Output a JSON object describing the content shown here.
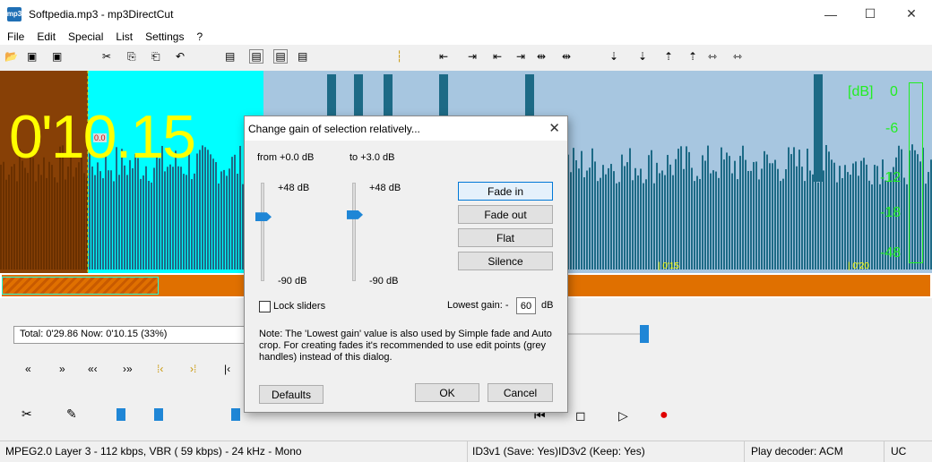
{
  "window": {
    "title": "Softpedia.mp3 - mp3DirectCut",
    "icon_text": "mp3",
    "minimize": "—",
    "maximize": "☐",
    "close": "✕"
  },
  "menu": [
    "File",
    "Edit",
    "Special",
    "List",
    "Settings",
    "?"
  ],
  "waveform": {
    "time_display": "0'10.15",
    "db_unit": "[dB]",
    "db_levels": [
      "0",
      "-6",
      "-12",
      "-18",
      "-48"
    ],
    "selection_marker": "0.0",
    "timeline_labels": [
      "0'15",
      "0'20"
    ]
  },
  "info": {
    "text": "Total: 0'29.86   Now: 0'10.15   (33%)"
  },
  "status": {
    "format": "MPEG2.0 Layer 3 - 112 kbps, VBR ( 59 kbps) - 24 kHz - Mono",
    "id3v1": "ID3v1 (Save: Yes)",
    "id3v2": "ID3v2 (Keep: Yes)",
    "decoder": "Play decoder: ACM",
    "uc": "UC"
  },
  "dialog": {
    "title": "Change gain of selection relatively...",
    "close": "✕",
    "from_label": "from +0.0 dB",
    "to_label": "to +3.0 dB",
    "from_top": "+48 dB",
    "from_bottom": "-90 dB",
    "to_top": "+48 dB",
    "to_bottom": "-90 dB",
    "from_gain_db": 0.0,
    "to_gain_db": 3.0,
    "buttons": {
      "fade_in": "Fade in",
      "fade_out": "Fade out",
      "flat": "Flat",
      "silence": "Silence"
    },
    "lock_label": "Lock sliders",
    "lowest_gain_label": "Lowest gain:  -",
    "lowest_gain_value": "60",
    "lowest_gain_unit": "dB",
    "note": "Note: The 'Lowest gain' value is also used by Simple fade and Auto crop. For creating fades it's recommended to use edit points (grey handles) instead of this dialog.",
    "defaults": "Defaults",
    "ok": "OK",
    "cancel": "Cancel"
  },
  "colors": {
    "wave_bg": "#a7c6e0",
    "wave_fg": "#1d6a86",
    "selection": "#00ffff",
    "pre_selection": "#874006",
    "time_text": "#ffff00",
    "db_text": "#22ee22",
    "accent": "#1f86d6",
    "overview_bar": "#e07000"
  }
}
